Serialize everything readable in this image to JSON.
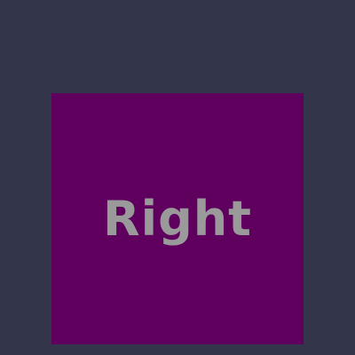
{
  "background_color": "#33364b",
  "tile": {
    "label": "Right",
    "color": "#5f005f",
    "label_color": "#9a9a9a"
  }
}
